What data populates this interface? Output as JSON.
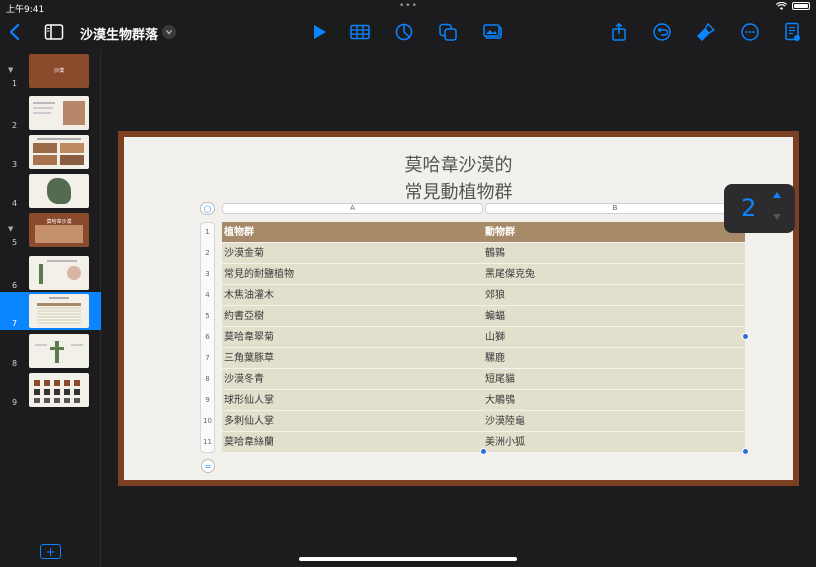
{
  "status": {
    "time": "上午9:41",
    "dots": "•••"
  },
  "toolbar": {
    "doc_title": "沙漠生物群落",
    "icons": [
      "back-chevron-icon",
      "sidebar-icon",
      "play-icon",
      "table-icon",
      "chart-icon",
      "shapes-icon",
      "media-icon",
      "share-icon",
      "undo-icon",
      "format-brush-icon",
      "more-icon",
      "document-icon"
    ],
    "accent": "#0a84ff"
  },
  "sidebar": {
    "slides": [
      {
        "num": "1",
        "label": "沙漠",
        "collapsed_group": true
      },
      {
        "num": "2"
      },
      {
        "num": "3"
      },
      {
        "num": "4"
      },
      {
        "num": "5",
        "label": "莫哈韋沙漠",
        "collapsed_group": true
      },
      {
        "num": "6"
      },
      {
        "num": "7",
        "selected": true
      },
      {
        "num": "8"
      },
      {
        "num": "9"
      }
    ],
    "add_label": "+"
  },
  "slide": {
    "title_line1": "莫哈韋沙漠的",
    "title_line2": "常見動植物群",
    "column_headers": [
      "A",
      "B"
    ],
    "rows": [
      {
        "n": "1",
        "a": "植物群",
        "b": "動物群",
        "header": true
      },
      {
        "n": "2",
        "a": "沙漠金菊",
        "b": "鶴鶉"
      },
      {
        "n": "3",
        "a": "常見的耐鹽植物",
        "b": "黑尾傑克兔"
      },
      {
        "n": "4",
        "a": "木焦油灌木",
        "b": "郊狼"
      },
      {
        "n": "5",
        "a": "約書亞樹",
        "b": "蝙蝠"
      },
      {
        "n": "6",
        "a": "莫哈韋翠菊",
        "b": "山獅"
      },
      {
        "n": "7",
        "a": "三角葉豚草",
        "b": "騾鹿"
      },
      {
        "n": "8",
        "a": "沙漠冬青",
        "b": "短尾貓"
      },
      {
        "n": "9",
        "a": "球形仙人掌",
        "b": "大鵰鴞"
      },
      {
        "n": "10",
        "a": "多刺仙人掌",
        "b": "沙漠陸龜"
      },
      {
        "n": "11",
        "a": "莫哈韋絲蘭",
        "b": "美洲小狐"
      }
    ]
  },
  "stepper": {
    "value": "2"
  }
}
